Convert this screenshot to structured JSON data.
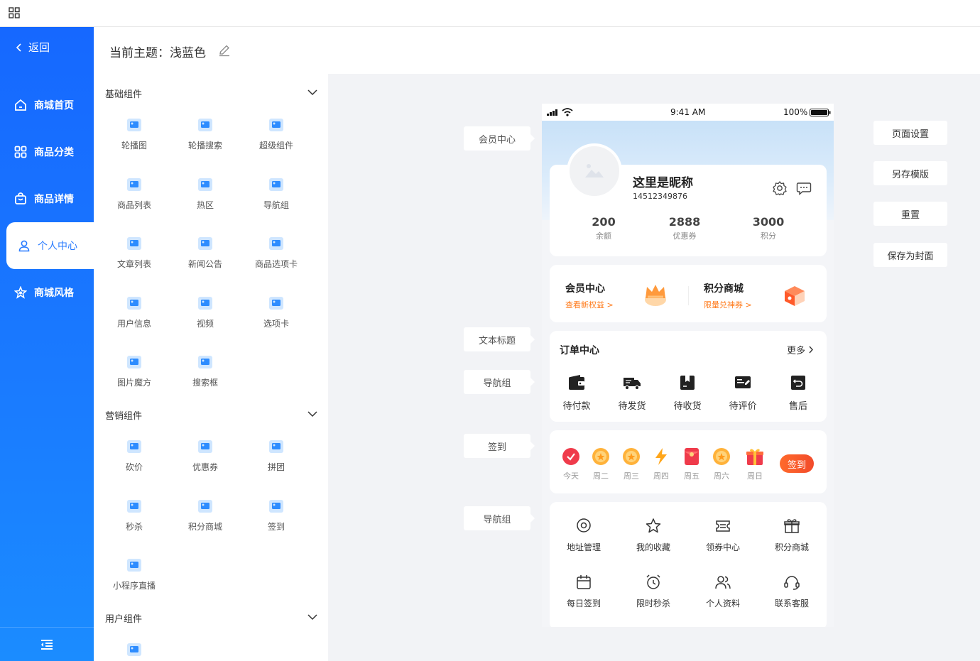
{
  "sidebar": {
    "back_label": "返回",
    "items": [
      {
        "label": "商城首页"
      },
      {
        "label": "商品分类"
      },
      {
        "label": "商品详情"
      },
      {
        "label": "个人中心"
      },
      {
        "label": "商城风格"
      }
    ]
  },
  "theme": {
    "title": "当前主题：浅蓝色"
  },
  "palette": {
    "groups": [
      {
        "title": "基础组件",
        "items": [
          "轮播图",
          "轮播搜索",
          "超级组件",
          "商品列表",
          "热区",
          "导航组",
          "文章列表",
          "新闻公告",
          "商品选项卡",
          "用户信息",
          "视频",
          "选项卡",
          "图片魔方",
          "搜索框"
        ]
      },
      {
        "title": "营销组件",
        "items": [
          "砍价",
          "优惠券",
          "拼团",
          "秒杀",
          "积分商城",
          "签到",
          "小程序直播"
        ]
      },
      {
        "title": "用户组件",
        "items": [
          ""
        ]
      }
    ]
  },
  "canvas": {
    "side_tags": [
      "会员中心",
      "文本标题",
      "导航组",
      "签到",
      "导航组"
    ],
    "right_buttons": [
      "页面设置",
      "另存模版",
      "重置",
      "保存为封面"
    ]
  },
  "phone": {
    "status": {
      "time": "9:41 AM",
      "battery": "100%"
    },
    "user": {
      "nickname": "这里是昵称",
      "uid": "14512349876",
      "stats": [
        {
          "value": "200",
          "label": "余额"
        },
        {
          "value": "2888",
          "label": "优惠券"
        },
        {
          "value": "3000",
          "label": "积分"
        }
      ]
    },
    "member": [
      {
        "title": "会员中心",
        "sub": "查看新权益 >"
      },
      {
        "title": "积分商城",
        "sub": "限量兑神券 >"
      }
    ],
    "orders": {
      "title": "订单中心",
      "more": "更多",
      "items": [
        "待付款",
        "待发货",
        "待收货",
        "待评价",
        "售后"
      ]
    },
    "signin": {
      "days": [
        "今天",
        "周二",
        "周三",
        "周四",
        "周五",
        "周六",
        "周日"
      ],
      "button": "签到"
    },
    "nav_grid": [
      "地址管理",
      "我的收藏",
      "领券中心",
      "积分商城",
      "每日签到",
      "限时秒杀",
      "个人资料",
      "联系客服"
    ]
  },
  "colors": {
    "primary": "#1a73ff",
    "accent": "#ff7a1a",
    "icon_light": "#2d8cff"
  }
}
